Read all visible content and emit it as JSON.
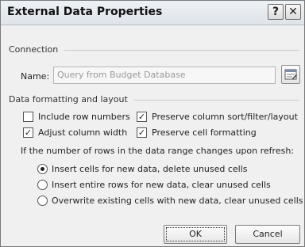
{
  "window": {
    "title": "External Data Properties",
    "help_label": "?",
    "close_label": "✕"
  },
  "connection": {
    "section_label": "Connection",
    "name_label": "Name:",
    "name_value": "Query from Budget Database"
  },
  "formatting": {
    "section_label": "Data formatting and layout",
    "options": [
      {
        "label": "Include row numbers",
        "checked": false
      },
      {
        "label": "Preserve column sort/filter/layout",
        "checked": true
      },
      {
        "label": "Adjust column width",
        "checked": true
      },
      {
        "label": "Preserve cell formatting",
        "checked": true
      }
    ]
  },
  "refresh": {
    "question": "If the number of rows in the data range changes upon refresh:",
    "options": [
      {
        "label": "Insert cells for new data, delete unused cells",
        "selected": true
      },
      {
        "label": "Insert entire rows for new data, clear unused cells",
        "selected": false
      },
      {
        "label": "Overwrite existing cells with new data, clear unused cells",
        "selected": false
      }
    ]
  },
  "buttons": {
    "ok_label": "OK",
    "cancel_label": "Cancel"
  },
  "check_glyph": "✓"
}
